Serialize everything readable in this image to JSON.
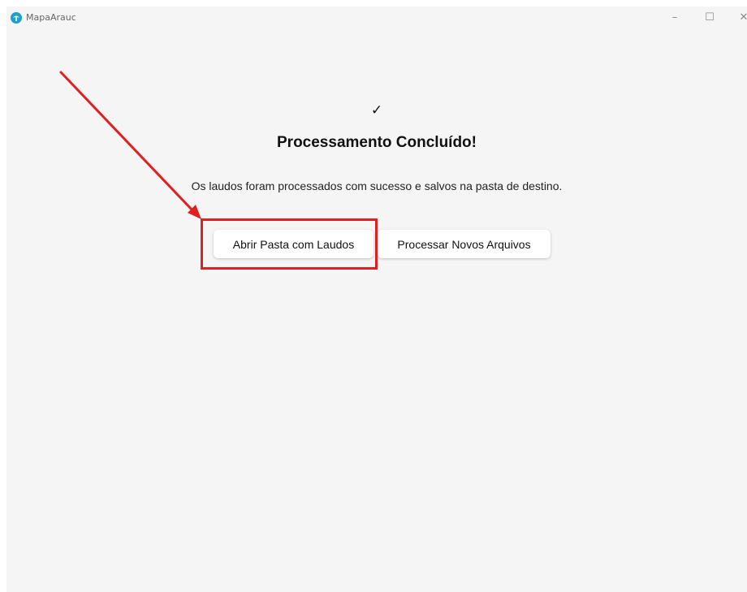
{
  "window": {
    "title": "MapaArauc",
    "controls": {
      "minimize": "–",
      "maximize": "☐",
      "close": "✕"
    }
  },
  "main": {
    "check_mark": "✓",
    "heading": "Processamento Concluído!",
    "message": "Os laudos foram processados com sucesso e salvos na pasta de destino.",
    "buttons": {
      "open_folder": "Abrir Pasta com Laudos",
      "process_new": "Processar Novos Arquivos"
    }
  },
  "annotation": {
    "color": "#e02020"
  },
  "colors": {
    "background": "#f5f5f5",
    "button_bg": "#ffffff",
    "app_icon": "#1aa3c8"
  }
}
